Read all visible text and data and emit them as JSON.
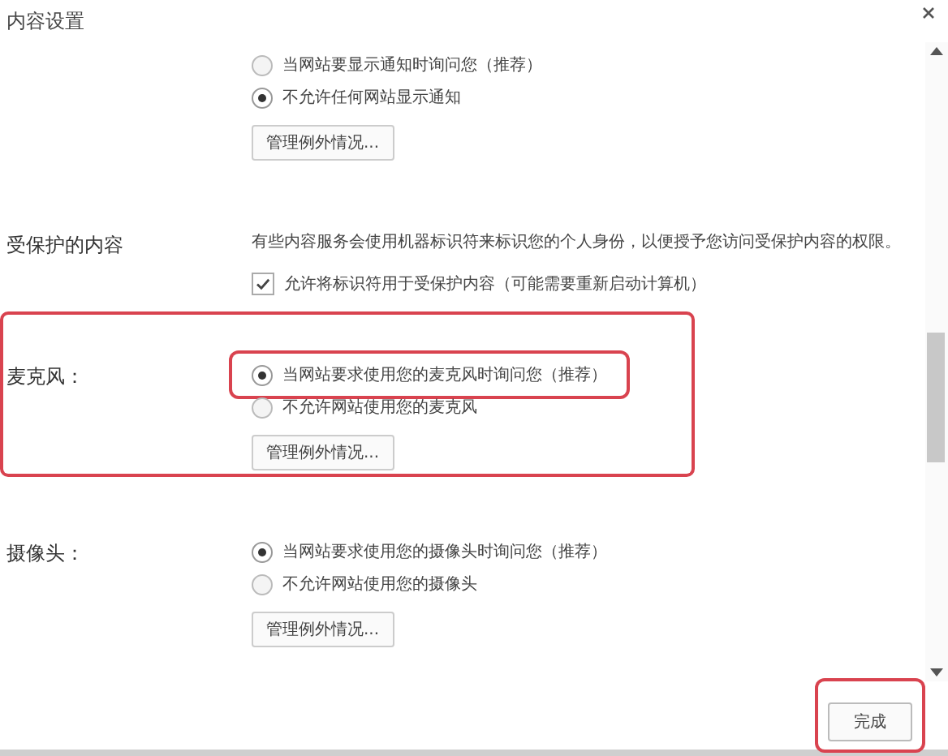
{
  "window": {
    "title": "内容设置"
  },
  "sections": [
    {
      "highlighted": false,
      "options": [
        {
          "kind": "radio",
          "text": "当网站要显示通知时询问您（推荐）",
          "selected": false,
          "highlighted": false
        },
        {
          "kind": "radio",
          "text": "不允许任何网站显示通知",
          "selected": true,
          "highlighted": false
        }
      ],
      "button": "管理例外情况..."
    },
    {
      "label": "受保护的内容",
      "highlighted": false,
      "description": "有些内容服务会使用机器标识符来标识您的个人身份，以便授予您访问受保护内容的权限。",
      "options": [
        {
          "kind": "checkbox",
          "text": "允许将标识符用于受保护内容（可能需要重新启动计算机）",
          "checked": true,
          "highlighted": false
        }
      ]
    },
    {
      "label": "麦克风：",
      "highlighted": true,
      "options": [
        {
          "kind": "radio",
          "text": "当网站要求使用您的麦克风时询问您（推荐）",
          "selected": true,
          "highlighted": true
        },
        {
          "kind": "radio",
          "text": "不允许网站使用您的麦克风",
          "selected": false,
          "highlighted": false
        }
      ],
      "button": "管理例外情况..."
    },
    {
      "label": "摄像头：",
      "highlighted": false,
      "options": [
        {
          "kind": "radio",
          "text": "当网站要求使用您的摄像头时询问您（推荐）",
          "selected": true,
          "highlighted": false
        },
        {
          "kind": "radio",
          "text": "不允许网站使用您的摄像头",
          "selected": false,
          "highlighted": false
        }
      ],
      "button": "管理例外情况..."
    }
  ],
  "footer": {
    "done_button": {
      "label": "完成",
      "highlighted": true
    }
  }
}
